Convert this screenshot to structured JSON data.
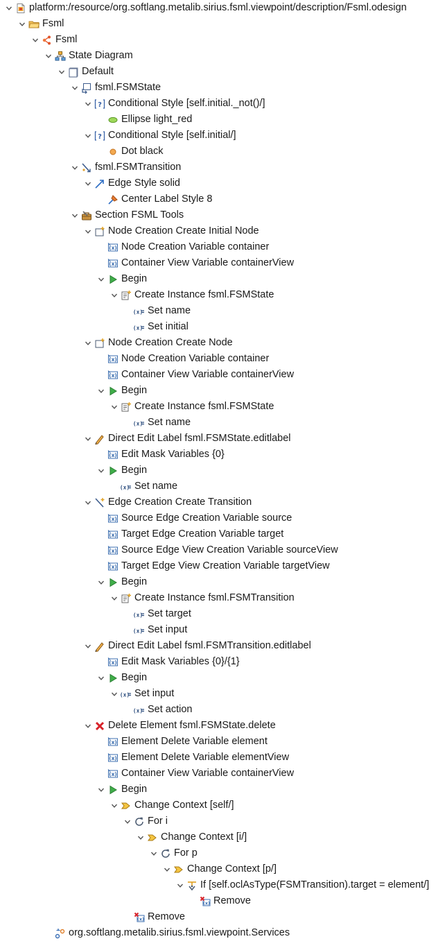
{
  "tree": [
    {
      "label": "platform:/resource/org.softlang.metalib.sirius.fsml.viewpoint/description/Fsml.odesign",
      "icon": "odesign-file-icon",
      "level": 0,
      "expanded": true
    },
    {
      "label": "Fsml",
      "icon": "group-folder-icon",
      "level": 1,
      "expanded": true
    },
    {
      "label": "Fsml",
      "icon": "viewpoint-icon",
      "level": 2,
      "expanded": true
    },
    {
      "label": "State Diagram",
      "icon": "diagram-description-icon",
      "level": 3,
      "expanded": true
    },
    {
      "label": "Default",
      "icon": "layer-icon",
      "level": 4,
      "expanded": true
    },
    {
      "label": "fsml.FSMState",
      "icon": "node-mapping-icon",
      "level": 5,
      "expanded": true
    },
    {
      "label": "Conditional Style [self.initial._not()/]",
      "icon": "conditional-style-icon",
      "level": 6,
      "expanded": true
    },
    {
      "label": "Ellipse light_red",
      "icon": "ellipse-style-icon",
      "level": 7,
      "expanded": null
    },
    {
      "label": "Conditional Style [self.initial/]",
      "icon": "conditional-style-icon",
      "level": 6,
      "expanded": true
    },
    {
      "label": "Dot black",
      "icon": "dot-style-icon",
      "level": 7,
      "expanded": null
    },
    {
      "label": "fsml.FSMTransition",
      "icon": "edge-mapping-icon",
      "level": 5,
      "expanded": true
    },
    {
      "label": "Edge Style solid",
      "icon": "edge-style-icon",
      "level": 6,
      "expanded": true
    },
    {
      "label": "Center Label Style 8",
      "icon": "label-style-icon",
      "level": 7,
      "expanded": null
    },
    {
      "label": "Section FSML Tools",
      "icon": "tool-section-icon",
      "level": 5,
      "expanded": true
    },
    {
      "label": "Node Creation Create Initial Node",
      "icon": "node-creation-icon",
      "level": 6,
      "expanded": true
    },
    {
      "label": "Node Creation Variable container",
      "icon": "variable-icon",
      "level": 7,
      "expanded": null
    },
    {
      "label": "Container View Variable containerView",
      "icon": "variable-icon",
      "level": 7,
      "expanded": null
    },
    {
      "label": "Begin",
      "icon": "begin-icon",
      "level": 7,
      "expanded": true
    },
    {
      "label": "Create Instance fsml.FSMState",
      "icon": "create-instance-icon",
      "level": 8,
      "expanded": true
    },
    {
      "label": "Set name",
      "icon": "set-value-icon",
      "level": 9,
      "expanded": null
    },
    {
      "label": "Set initial",
      "icon": "set-value-icon",
      "level": 9,
      "expanded": null
    },
    {
      "label": "Node Creation Create Node",
      "icon": "node-creation-icon",
      "level": 6,
      "expanded": true
    },
    {
      "label": "Node Creation Variable container",
      "icon": "variable-icon",
      "level": 7,
      "expanded": null
    },
    {
      "label": "Container View Variable containerView",
      "icon": "variable-icon",
      "level": 7,
      "expanded": null
    },
    {
      "label": "Begin",
      "icon": "begin-icon",
      "level": 7,
      "expanded": true
    },
    {
      "label": "Create Instance fsml.FSMState",
      "icon": "create-instance-icon",
      "level": 8,
      "expanded": true
    },
    {
      "label": "Set name",
      "icon": "set-value-icon",
      "level": 9,
      "expanded": null
    },
    {
      "label": "Direct Edit Label fsml.FSMState.editlabel",
      "icon": "direct-edit-icon",
      "level": 6,
      "expanded": true
    },
    {
      "label": "Edit Mask Variables {0}",
      "icon": "variable-icon",
      "level": 7,
      "expanded": null
    },
    {
      "label": "Begin",
      "icon": "begin-icon",
      "level": 7,
      "expanded": true
    },
    {
      "label": "Set name",
      "icon": "set-value-icon",
      "level": 8,
      "expanded": null
    },
    {
      "label": "Edge Creation Create Transition",
      "icon": "edge-creation-icon",
      "level": 6,
      "expanded": true
    },
    {
      "label": "Source Edge Creation Variable source",
      "icon": "variable-icon",
      "level": 7,
      "expanded": null
    },
    {
      "label": "Target Edge Creation Variable target",
      "icon": "variable-icon",
      "level": 7,
      "expanded": null
    },
    {
      "label": "Source Edge View Creation Variable sourceView",
      "icon": "variable-icon",
      "level": 7,
      "expanded": null
    },
    {
      "label": "Target Edge View Creation Variable targetView",
      "icon": "variable-icon",
      "level": 7,
      "expanded": null
    },
    {
      "label": "Begin",
      "icon": "begin-icon",
      "level": 7,
      "expanded": true
    },
    {
      "label": "Create Instance fsml.FSMTransition",
      "icon": "create-instance-icon",
      "level": 8,
      "expanded": true
    },
    {
      "label": "Set target",
      "icon": "set-value-icon",
      "level": 9,
      "expanded": null
    },
    {
      "label": "Set input",
      "icon": "set-value-icon",
      "level": 9,
      "expanded": null
    },
    {
      "label": "Direct Edit Label fsml.FSMTransition.editlabel",
      "icon": "direct-edit-icon",
      "level": 6,
      "expanded": true
    },
    {
      "label": "Edit Mask Variables {0}/{1}",
      "icon": "variable-icon",
      "level": 7,
      "expanded": null
    },
    {
      "label": "Begin",
      "icon": "begin-icon",
      "level": 7,
      "expanded": true
    },
    {
      "label": "Set input",
      "icon": "set-value-icon",
      "level": 8,
      "expanded": true
    },
    {
      "label": "Set action",
      "icon": "set-value-icon",
      "level": 9,
      "expanded": null
    },
    {
      "label": "Delete Element fsml.FSMState.delete",
      "icon": "delete-icon",
      "level": 6,
      "expanded": true
    },
    {
      "label": "Element Delete Variable element",
      "icon": "variable-icon",
      "level": 7,
      "expanded": null
    },
    {
      "label": "Element Delete Variable elementView",
      "icon": "variable-icon",
      "level": 7,
      "expanded": null
    },
    {
      "label": "Container View Variable containerView",
      "icon": "variable-icon",
      "level": 7,
      "expanded": null
    },
    {
      "label": "Begin",
      "icon": "begin-icon",
      "level": 7,
      "expanded": true
    },
    {
      "label": "Change Context [self/]",
      "icon": "change-context-icon",
      "level": 8,
      "expanded": true
    },
    {
      "label": "For i",
      "icon": "for-loop-icon",
      "level": 9,
      "expanded": true
    },
    {
      "label": "Change Context [i/]",
      "icon": "change-context-icon",
      "level": 10,
      "expanded": true
    },
    {
      "label": "For p",
      "icon": "for-loop-icon",
      "level": 11,
      "expanded": true
    },
    {
      "label": "Change Context [p/]",
      "icon": "change-context-icon",
      "level": 12,
      "expanded": true
    },
    {
      "label": "If [self.oclAsType(FSMTransition).target = element/]",
      "icon": "if-icon",
      "level": 13,
      "expanded": true
    },
    {
      "label": "Remove",
      "icon": "remove-icon",
      "level": 14,
      "expanded": null
    },
    {
      "label": "Remove",
      "icon": "remove-icon",
      "level": 9,
      "expanded": null
    },
    {
      "label": "org.softlang.metalib.sirius.fsml.viewpoint.Services",
      "icon": "java-extension-icon",
      "level": 3,
      "expanded": null
    }
  ]
}
